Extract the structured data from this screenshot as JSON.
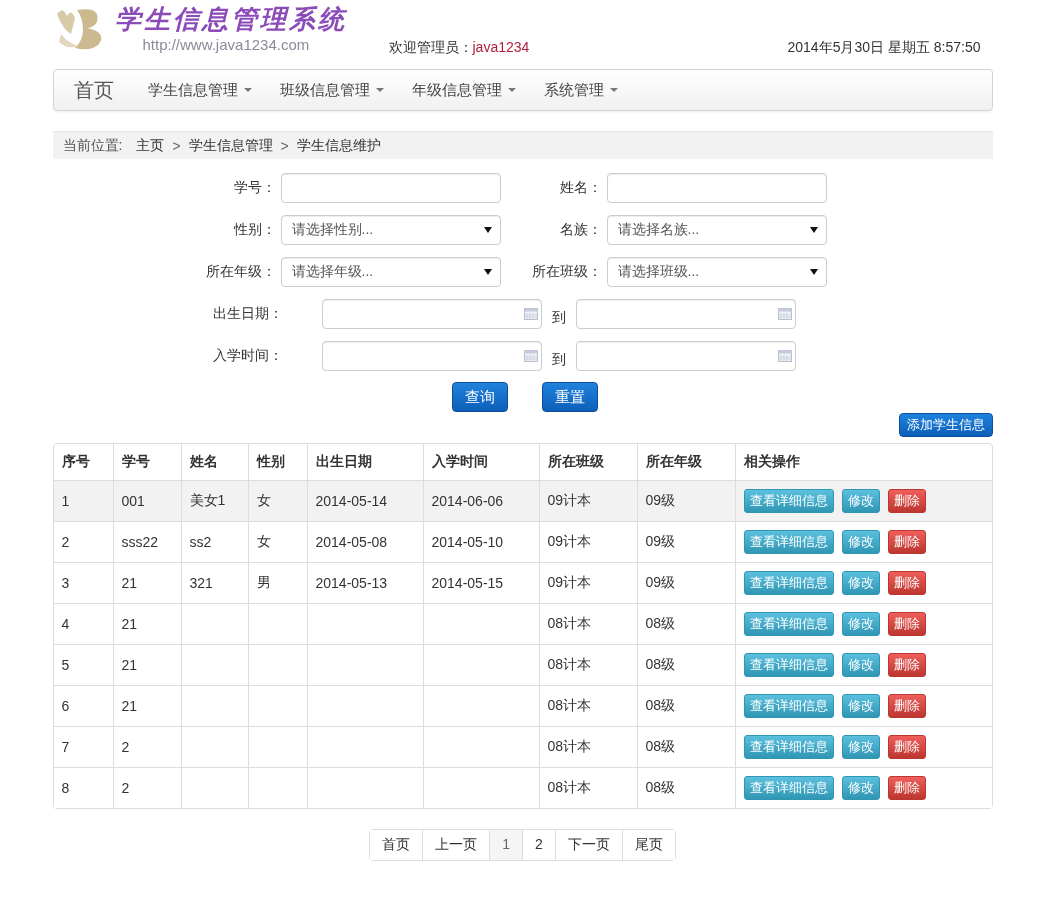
{
  "header": {
    "title": "学生信息管理系统",
    "url": "http://www.java1234.com",
    "welcome_label": "欢迎管理员：",
    "user": "java1234",
    "datetime": "2014年5月30日 星期五 8:57:50"
  },
  "nav": {
    "brand": "首页",
    "menus": [
      "学生信息管理",
      "班级信息管理",
      "年级信息管理",
      "系统管理"
    ]
  },
  "breadcrumb": {
    "label": "当前位置:",
    "separator": ">",
    "items": [
      "主页",
      "学生信息管理",
      "学生信息维护"
    ]
  },
  "search_form": {
    "rows": [
      {
        "kind": "pair",
        "fields": [
          {
            "label": "学号：",
            "kind": "text"
          },
          {
            "label": "姓名：",
            "kind": "text"
          }
        ]
      },
      {
        "kind": "pair",
        "fields": [
          {
            "label": "性别：",
            "kind": "select",
            "placeholder": "请选择性别..."
          },
          {
            "label": "名族：",
            "kind": "select",
            "placeholder": "请选择名族..."
          }
        ]
      },
      {
        "kind": "pair",
        "fields": [
          {
            "label": "所在年级：",
            "kind": "select",
            "placeholder": "请选择年级..."
          },
          {
            "label": "所在班级：",
            "kind": "select",
            "placeholder": "请选择班级..."
          }
        ]
      },
      {
        "kind": "range",
        "label": "出生日期：",
        "separator": "到"
      },
      {
        "kind": "range",
        "label": "入学时间：",
        "separator": "到"
      }
    ],
    "buttons": [
      "查询",
      "重置"
    ]
  },
  "add_button": "添加学生信息",
  "table": {
    "columns": [
      "序号",
      "学号",
      "姓名",
      "性别",
      "出生日期",
      "入学时间",
      "所在班级",
      "所在年级",
      "相关操作"
    ],
    "rows": [
      {
        "highlighted": true,
        "cells": [
          "1",
          "001",
          "美女1",
          "女",
          "2014-05-14",
          "2014-06-06",
          "09计本",
          "09级"
        ],
        "actions": [
          {
            "label": "查看详细信息",
            "kind": "info"
          },
          {
            "label": "修改",
            "kind": "info"
          },
          {
            "label": "删除",
            "kind": "danger"
          }
        ]
      },
      {
        "highlighted": false,
        "cells": [
          "2",
          "sss22",
          "ss2",
          "女",
          "2014-05-08",
          "2014-05-10",
          "09计本",
          "09级"
        ],
        "actions": [
          {
            "label": "查看详细信息",
            "kind": "info"
          },
          {
            "label": "修改",
            "kind": "info"
          },
          {
            "label": "删除",
            "kind": "danger"
          }
        ]
      },
      {
        "highlighted": false,
        "cells": [
          "3",
          "21",
          "321",
          "男",
          "2014-05-13",
          "2014-05-15",
          "09计本",
          "09级"
        ],
        "actions": [
          {
            "label": "查看详细信息",
            "kind": "info"
          },
          {
            "label": "修改",
            "kind": "info"
          },
          {
            "label": "删除",
            "kind": "danger"
          }
        ]
      },
      {
        "highlighted": false,
        "cells": [
          "4",
          "21",
          "",
          "",
          "",
          "",
          "08计本",
          "08级"
        ],
        "actions": [
          {
            "label": "查看详细信息",
            "kind": "info"
          },
          {
            "label": "修改",
            "kind": "info"
          },
          {
            "label": "删除",
            "kind": "danger"
          }
        ]
      },
      {
        "highlighted": false,
        "cells": [
          "5",
          "21",
          "",
          "",
          "",
          "",
          "08计本",
          "08级"
        ],
        "actions": [
          {
            "label": "查看详细信息",
            "kind": "info"
          },
          {
            "label": "修改",
            "kind": "info"
          },
          {
            "label": "删除",
            "kind": "danger"
          }
        ]
      },
      {
        "highlighted": false,
        "cells": [
          "6",
          "21",
          "",
          "",
          "",
          "",
          "08计本",
          "08级"
        ],
        "actions": [
          {
            "label": "查看详细信息",
            "kind": "info"
          },
          {
            "label": "修改",
            "kind": "info"
          },
          {
            "label": "删除",
            "kind": "danger"
          }
        ]
      },
      {
        "highlighted": false,
        "cells": [
          "7",
          "2",
          "",
          "",
          "",
          "",
          "08计本",
          "08级"
        ],
        "actions": [
          {
            "label": "查看详细信息",
            "kind": "info"
          },
          {
            "label": "修改",
            "kind": "info"
          },
          {
            "label": "删除",
            "kind": "danger"
          }
        ]
      },
      {
        "highlighted": false,
        "cells": [
          "8",
          "2",
          "",
          "",
          "",
          "",
          "08计本",
          "08级"
        ],
        "actions": [
          {
            "label": "查看详细信息",
            "kind": "info"
          },
          {
            "label": "修改",
            "kind": "info"
          },
          {
            "label": "删除",
            "kind": "danger"
          }
        ]
      }
    ]
  },
  "pagination": [
    {
      "label": "首页",
      "selected": false
    },
    {
      "label": "上一页",
      "selected": false
    },
    {
      "label": "1",
      "selected": true
    },
    {
      "label": "2",
      "selected": false
    },
    {
      "label": "下一页",
      "selected": false
    },
    {
      "label": "尾页",
      "selected": false
    }
  ]
}
